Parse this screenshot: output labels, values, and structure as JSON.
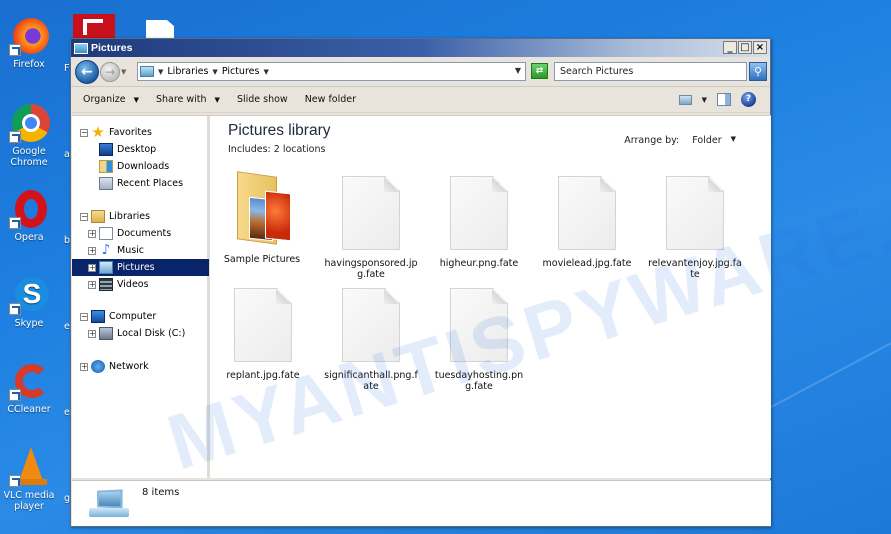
{
  "desktop": {
    "icons": [
      {
        "name": "firefox",
        "label": "Firefox"
      },
      {
        "name": "google-chrome",
        "label": "Google Chrome"
      },
      {
        "name": "opera",
        "label": "Opera"
      },
      {
        "name": "skype",
        "label": "Skype"
      },
      {
        "name": "ccleaner",
        "label": "CCleaner"
      },
      {
        "name": "vlc",
        "label": "VLC media player"
      }
    ],
    "partial_labels": [
      "F",
      "a",
      "b",
      "e",
      "e",
      "g"
    ]
  },
  "window": {
    "title": "Pictures",
    "controls": {
      "minimize": "_",
      "maximize": "□",
      "close": "×"
    },
    "address": {
      "crumbs": [
        "Libraries",
        "Pictures"
      ],
      "search_placeholder": "Search Pictures"
    },
    "toolbar": {
      "organize": "Organize",
      "share_with": "Share with",
      "slide_show": "Slide show",
      "new_folder": "New folder"
    },
    "nav_pane": {
      "favorites": "Favorites",
      "desktop": "Desktop",
      "downloads": "Downloads",
      "recent_places": "Recent Places",
      "libraries": "Libraries",
      "documents": "Documents",
      "music": "Music",
      "pictures": "Pictures",
      "videos": "Videos",
      "computer": "Computer",
      "local_disk": "Local Disk (C:)",
      "network": "Network",
      "selected": "Pictures"
    },
    "content": {
      "title": "Pictures library",
      "includes": "Includes:  2 locations",
      "arrange_label": "Arrange by:",
      "arrange_value": "Folder",
      "items": [
        {
          "type": "folder",
          "label": "Sample Pictures"
        },
        {
          "type": "file",
          "label": "havingsponsored.jpg.fate"
        },
        {
          "type": "file",
          "label": "higheur.png.fate"
        },
        {
          "type": "file",
          "label": "movielead.jpg.fate"
        },
        {
          "type": "file",
          "label": "relevantenjoy.jpg.fate"
        },
        {
          "type": "file",
          "label": "replant.jpg.fate"
        },
        {
          "type": "file",
          "label": "significanthall.png.fate"
        },
        {
          "type": "file",
          "label": "tuesdayhosting.png.fate"
        }
      ]
    },
    "status": {
      "item_count": "8 items"
    }
  },
  "watermark": "MYANTISPYWARE.COM"
}
